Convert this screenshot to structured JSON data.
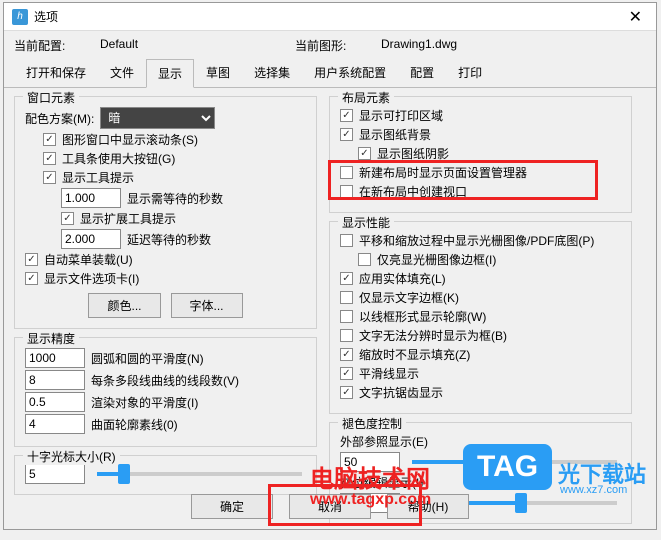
{
  "title": "选项",
  "current_config_label": "当前配置:",
  "current_config_value": "Default",
  "current_drawing_label": "当前图形:",
  "current_drawing_value": "Drawing1.dwg",
  "tabs": {
    "open_save": "打开和保存",
    "file": "文件",
    "display": "显示",
    "draft": "草图",
    "select": "选择集",
    "user_sys": "用户系统配置",
    "config": "配置",
    "print": "打印"
  },
  "window_elements": {
    "title": "窗口元素",
    "color_scheme_label": "配色方案(M):",
    "color_scheme_value": "暗",
    "scroll_bars": "图形窗口中显示滚动条(S)",
    "large_buttons": "工具条使用大按钮(G)",
    "show_tooltips": "显示工具提示",
    "tooltip_seconds": "1.000",
    "tooltip_seconds_label": "显示需等待的秒数",
    "ext_tooltips": "显示扩展工具提示",
    "ext_seconds": "2.000",
    "ext_seconds_label": "延迟等待的秒数",
    "auto_menu": "自动菜单装载(U)",
    "file_tabs": "显示文件选项卡(I)",
    "btn_color": "颜色...",
    "btn_font": "字体..."
  },
  "display_precision": {
    "title": "显示精度",
    "arc_value": "1000",
    "arc_label": "圆弧和圆的平滑度(N)",
    "poly_value": "8",
    "poly_label": "每条多段线曲线的线段数(V)",
    "render_value": "0.5",
    "render_label": "渲染对象的平滑度(I)",
    "surf_value": "4",
    "surf_label": "曲面轮廓素线(0)"
  },
  "crosshair": {
    "title": "十字光标大小(R)",
    "value": "5"
  },
  "layout_elements": {
    "title": "布局元素",
    "printable": "显示可打印区域",
    "paper_bg": "显示图纸背景",
    "paper_shadow": "显示图纸阴影",
    "new_layout_psetup": "新建布局时显示页面设置管理器",
    "create_viewport": "在新布局中创建视口"
  },
  "display_perf": {
    "title": "显示性能",
    "raster": "平移和缩放过程中显示光栅图像/PDF底图(P)",
    "highlight_border": "仅亮显光栅图像边框(I)",
    "solid_fill": "应用实体填充(L)",
    "text_border": "仅显示文字边框(K)",
    "wireframe": "以线框形式显示轮廓(W)",
    "illegible": "文字无法分辨时显示为框(B)",
    "no_fill_zoom": "缩放时不显示填充(Z)",
    "smooth_line": "平滑线显示",
    "antialias": "文字抗锯齿显示"
  },
  "fade": {
    "title": "褪色度控制",
    "xref_label": "外部参照显示(E)",
    "xref_value": "50",
    "inplace_label": "在位编辑显示(I)",
    "inplace_value": "50"
  },
  "footer": {
    "ok": "确定",
    "cancel": "取消",
    "help": "帮助(H)"
  },
  "overlay": {
    "site": "电脑技术网",
    "url": "www.tagxp.com",
    "tag": "TAG",
    "gx": "光下载站",
    "gxurl": "www.xz7.com"
  }
}
